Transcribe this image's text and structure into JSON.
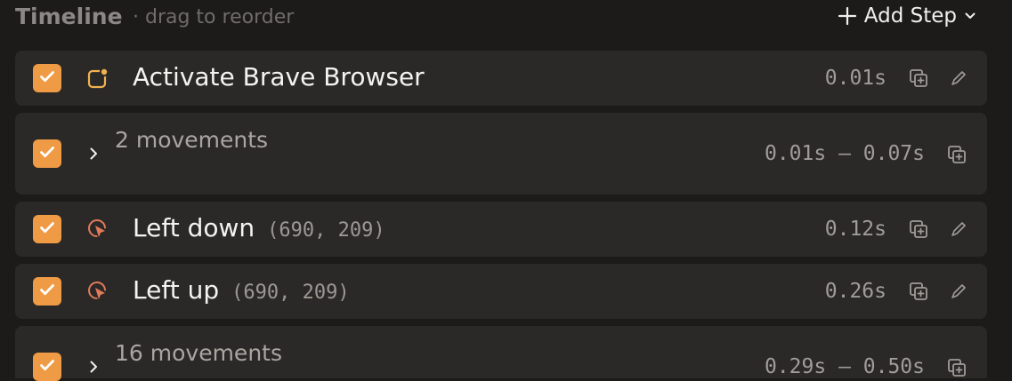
{
  "header": {
    "title": "Timeline",
    "subtitle": "· drag to reorder",
    "add_step_label": "Add Step"
  },
  "colors": {
    "background": "#1c1b1a",
    "row": "#2a2927",
    "checkbox": "#ef9a44",
    "app_icon": "#f0b24f",
    "click_icon": "#e07a5a"
  },
  "steps": [
    {
      "type": "action",
      "icon": "app-activate-icon",
      "label": "Activate Brave Browser",
      "coords": "",
      "time": "0.01s",
      "checked": true,
      "editable": true
    },
    {
      "type": "group",
      "label": "2 movements",
      "time": "0.01s — 0.07s",
      "checked": true,
      "collapsed": true
    },
    {
      "type": "action",
      "icon": "mouse-click-icon",
      "label": "Left down",
      "coords": "(690, 209)",
      "time": "0.12s",
      "checked": true,
      "editable": true
    },
    {
      "type": "action",
      "icon": "mouse-click-icon",
      "label": "Left up",
      "coords": "(690, 209)",
      "time": "0.26s",
      "checked": true,
      "editable": true
    },
    {
      "type": "group",
      "label": "16 movements",
      "time": "0.29s — 0.50s",
      "checked": true,
      "collapsed": true
    }
  ]
}
